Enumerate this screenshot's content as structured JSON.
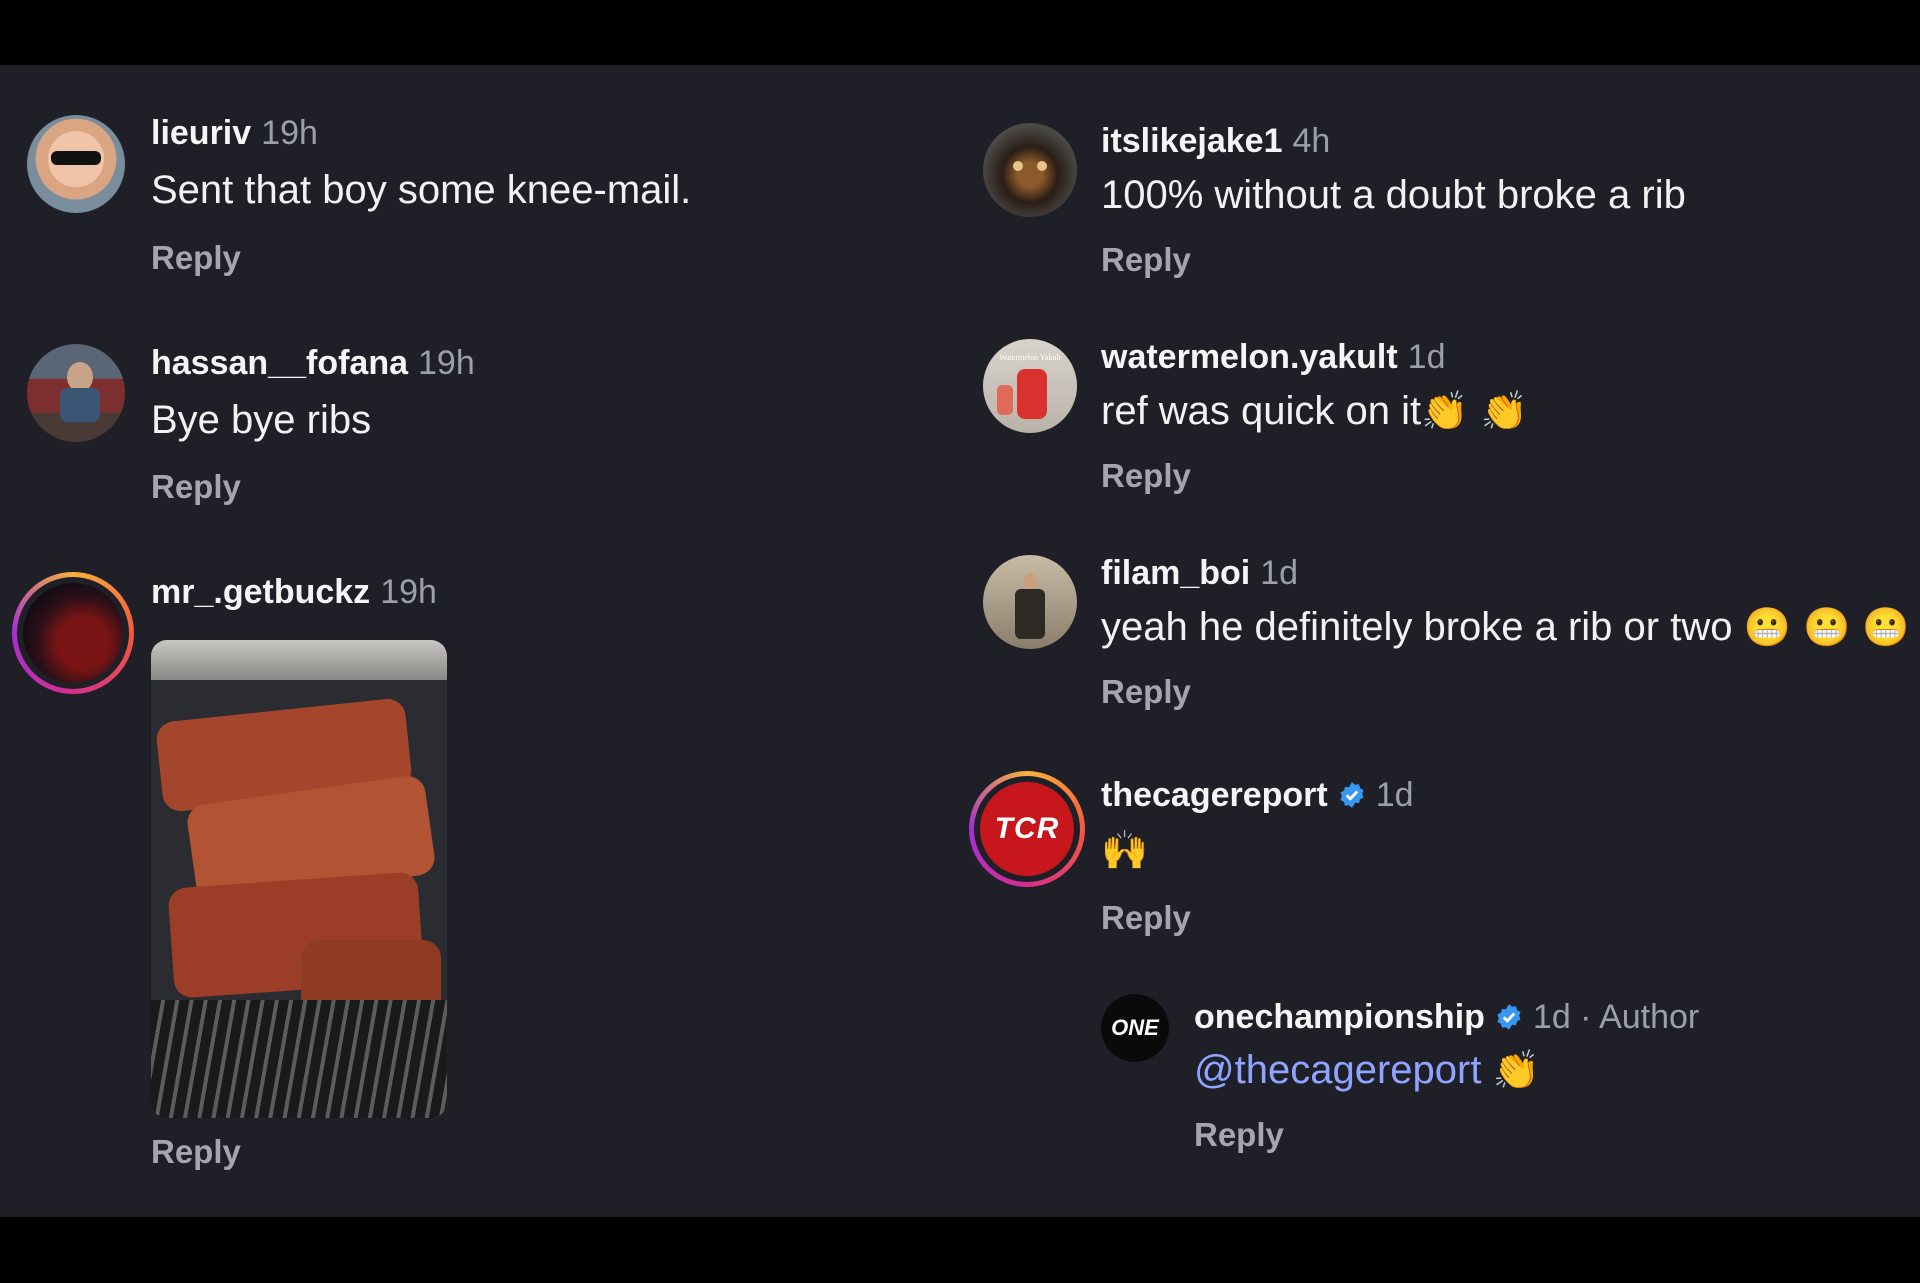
{
  "colors": {
    "background": "#1f2027",
    "username": "#f5f5f5",
    "meta": "#9aa0a8",
    "mention": "#8ea4ff",
    "verified": "#3897f0"
  },
  "left_comments": [
    {
      "username": "lieuriv",
      "time": "19h",
      "text": "Sent that boy some knee-mail.",
      "reply": "Reply"
    },
    {
      "username": "hassan__fofana",
      "time": "19h",
      "text": "Bye bye ribs",
      "reply": "Reply"
    },
    {
      "username": "mr_.getbuckz",
      "time": "19h",
      "image": "ribs-on-grill-photo",
      "reply": "Reply"
    }
  ],
  "right_comments": [
    {
      "username": "itslikejake1",
      "time": "4h",
      "text": "100% without a doubt broke a rib",
      "reply": "Reply"
    },
    {
      "username": "watermelon.yakult",
      "time": "1d",
      "text": "ref was quick on it",
      "emoji": "👏 👏",
      "reply": "Reply",
      "avatar_text": "Watermelon Yakult"
    },
    {
      "username": "filam_boi",
      "time": "1d",
      "text": "yeah he definitely broke a rib or two",
      "emoji": "😬 😬 😬",
      "reply": "Reply"
    },
    {
      "username": "thecagereport",
      "verified": true,
      "time": "1d",
      "emoji": "🙌",
      "reply": "Reply",
      "avatar_text": "TCR"
    }
  ],
  "nested_reply": {
    "username": "onechampionship",
    "verified": true,
    "time": "1d · Author",
    "mention": "@thecagereport",
    "emoji": "👏",
    "reply": "Reply",
    "avatar_text": "ONE"
  }
}
